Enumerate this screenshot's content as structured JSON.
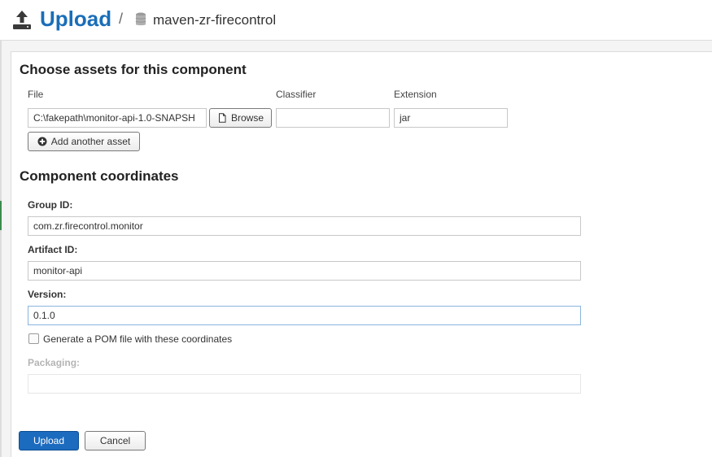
{
  "header": {
    "title": "Upload",
    "separator": "/",
    "repository": "maven-zr-firecontrol",
    "icon": "upload-icon",
    "repo_icon": "database-icon"
  },
  "assets": {
    "heading": "Choose assets for this component",
    "columns": {
      "file": "File",
      "classifier": "Classifier",
      "extension": "Extension"
    },
    "file_value": "C:\\fakepath\\monitor-api-1.0-SNAPSH",
    "browse_label": "Browse",
    "classifier_value": "",
    "extension_value": "jar",
    "add_another_label": "Add another asset"
  },
  "coordinates": {
    "heading": "Component coordinates",
    "group_id_label": "Group ID:",
    "group_id_value": "com.zr.firecontrol.monitor",
    "artifact_id_label": "Artifact ID:",
    "artifact_id_value": "monitor-api",
    "version_label": "Version:",
    "version_value": "0.1.0",
    "generate_pom_label": "Generate a POM file with these coordinates",
    "generate_pom_checked": false,
    "packaging_label": "Packaging:",
    "packaging_value": ""
  },
  "actions": {
    "upload_label": "Upload",
    "cancel_label": "Cancel"
  },
  "colors": {
    "accent": "#1a6eb8",
    "primary_button": "#1b6bbf",
    "focus_border": "#8ab4de"
  }
}
